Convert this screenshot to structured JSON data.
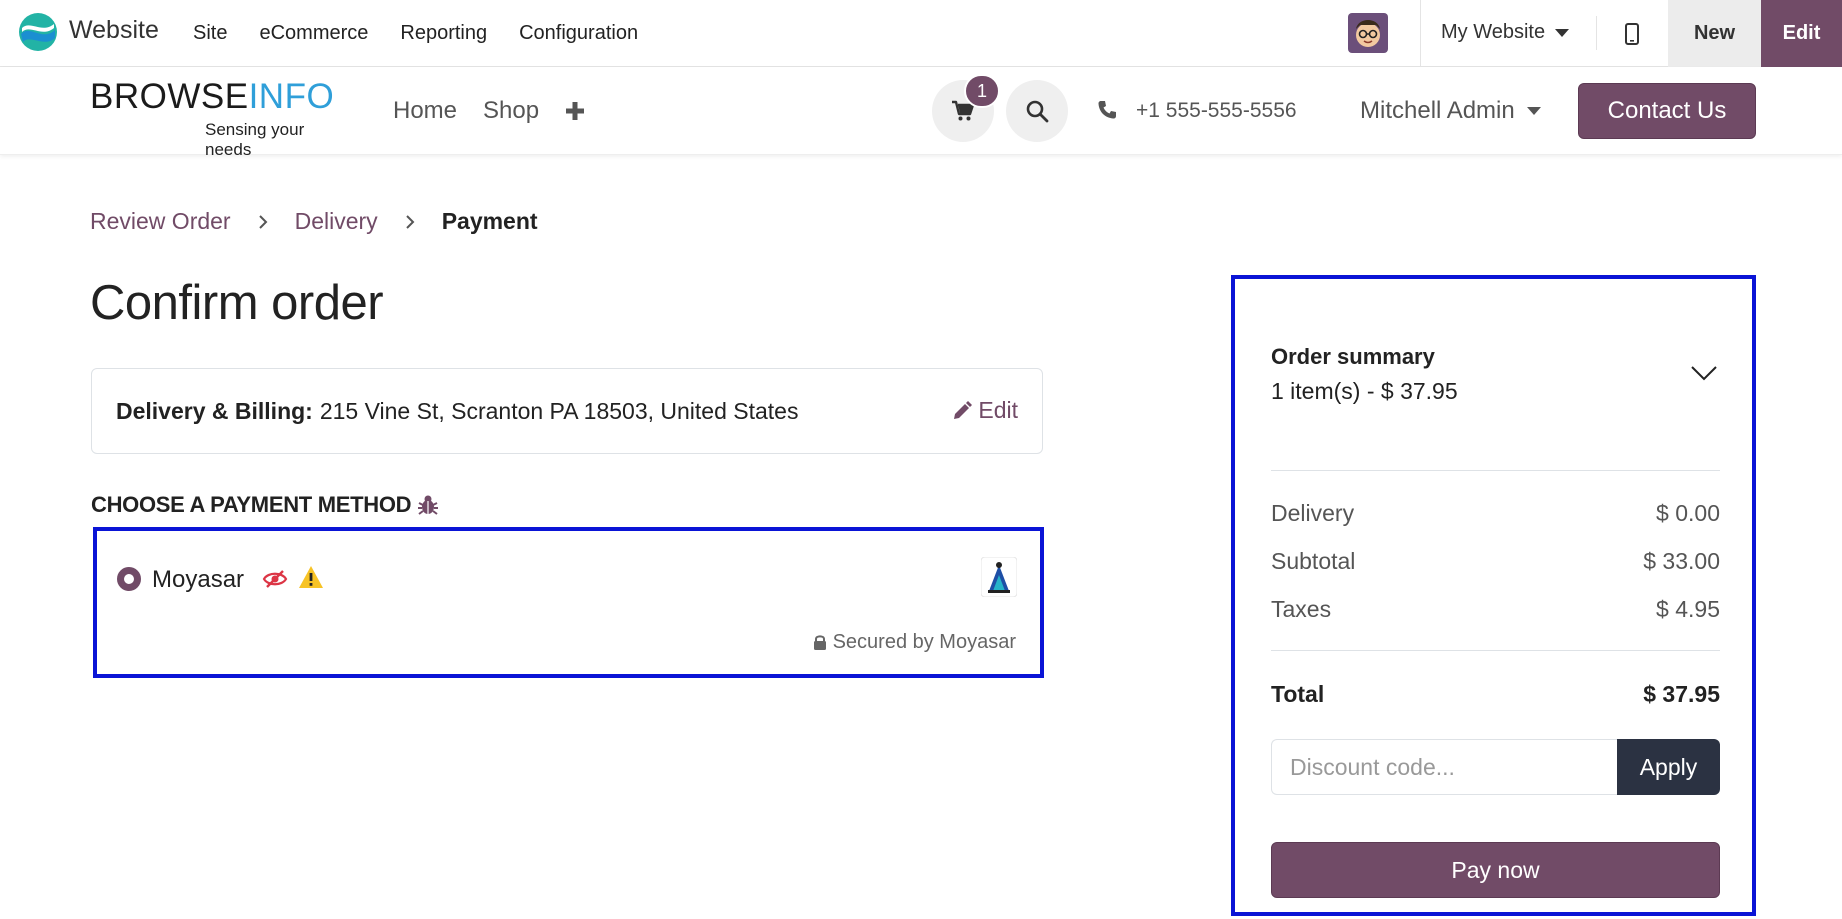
{
  "admin_bar": {
    "app_name": "Website",
    "menu": [
      "Site",
      "eCommerce",
      "Reporting",
      "Configuration"
    ],
    "website_selector": "My Website",
    "new_label": "New",
    "edit_label": "Edit",
    "accent_color": "#714b67"
  },
  "site_header": {
    "brand_part1": "BROWSE",
    "brand_part2": "INFO",
    "brand_tagline": "Sensing your needs",
    "nav": [
      "Home",
      "Shop"
    ],
    "cart_count": "1",
    "phone": "+1 555-555-5556",
    "user_name": "Mitchell Admin",
    "contact_label": "Contact Us"
  },
  "breadcrumb": {
    "step1": "Review Order",
    "step2": "Delivery",
    "step3": "Payment"
  },
  "main": {
    "title": "Confirm order",
    "address_label": "Delivery & Billing:",
    "address_value": "215 Vine St, Scranton PA 18503, United States",
    "address_edit": "Edit",
    "payment_heading": "CHOOSE A PAYMENT METHOD",
    "payment_method": {
      "name": "Moyasar",
      "secured_text": "Secured by Moyasar"
    }
  },
  "summary": {
    "title": "Order summary",
    "items_text": "1 item(s) -  $ 37.95",
    "rows": [
      {
        "label": "Delivery",
        "value": "$ 0.00"
      },
      {
        "label": "Subtotal",
        "value": "$ 33.00"
      },
      {
        "label": "Taxes",
        "value": "$ 4.95"
      }
    ],
    "total_label": "Total",
    "total_value": "$ 37.95",
    "discount_placeholder": "Discount code...",
    "apply_label": "Apply",
    "pay_label": "Pay now"
  }
}
